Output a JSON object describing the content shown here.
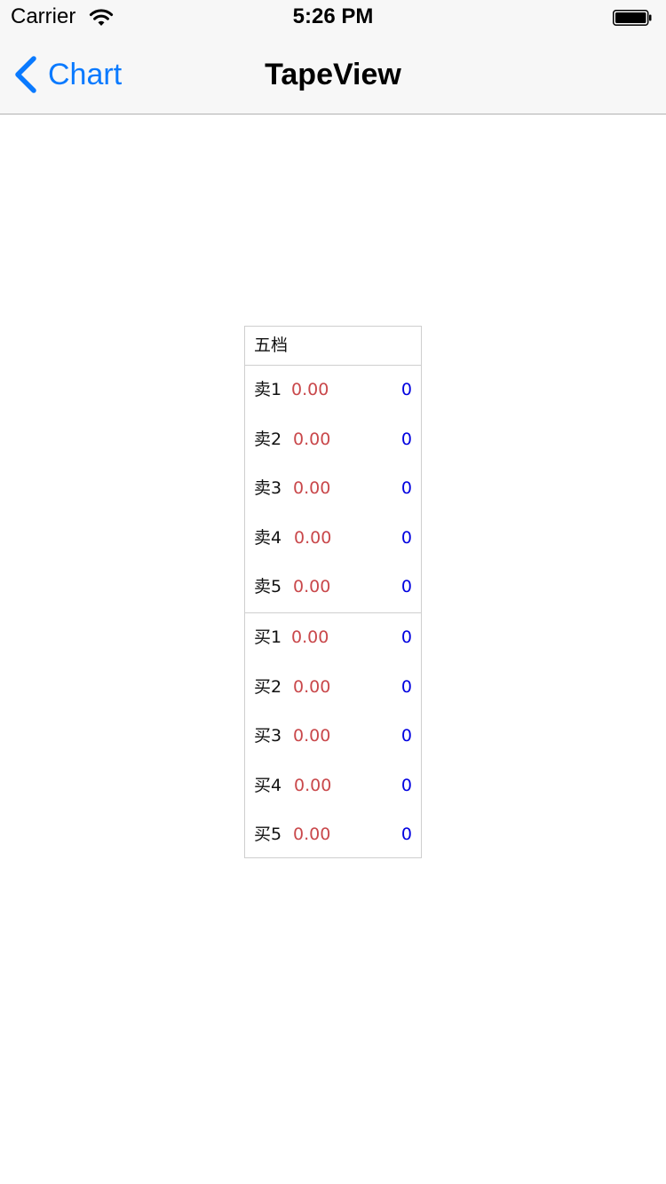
{
  "status_bar": {
    "carrier": "Carrier",
    "time": "5:26 PM"
  },
  "nav": {
    "back_label": "Chart",
    "title": "TapeView"
  },
  "tape": {
    "header": "五档",
    "sell": [
      {
        "label": "卖1",
        "price": "0.00",
        "volume": "0"
      },
      {
        "label": "卖2",
        "price": "0.00",
        "volume": "0"
      },
      {
        "label": "卖3",
        "price": "0.00",
        "volume": "0"
      },
      {
        "label": "卖4",
        "price": "0.00",
        "volume": "0"
      },
      {
        "label": "卖5",
        "price": "0.00",
        "volume": "0"
      }
    ],
    "buy": [
      {
        "label": "买1",
        "price": "0.00",
        "volume": "0"
      },
      {
        "label": "买2",
        "price": "0.00",
        "volume": "0"
      },
      {
        "label": "买3",
        "price": "0.00",
        "volume": "0"
      },
      {
        "label": "买4",
        "price": "0.00",
        "volume": "0"
      },
      {
        "label": "买5",
        "price": "0.00",
        "volume": "0"
      }
    ]
  },
  "colors": {
    "accent": "#0a7aff",
    "price": "#c9484b",
    "volume": "#0000e0"
  },
  "icons": {
    "back": "chevron-left-icon",
    "wifi": "wifi-icon",
    "battery": "battery-icon"
  }
}
